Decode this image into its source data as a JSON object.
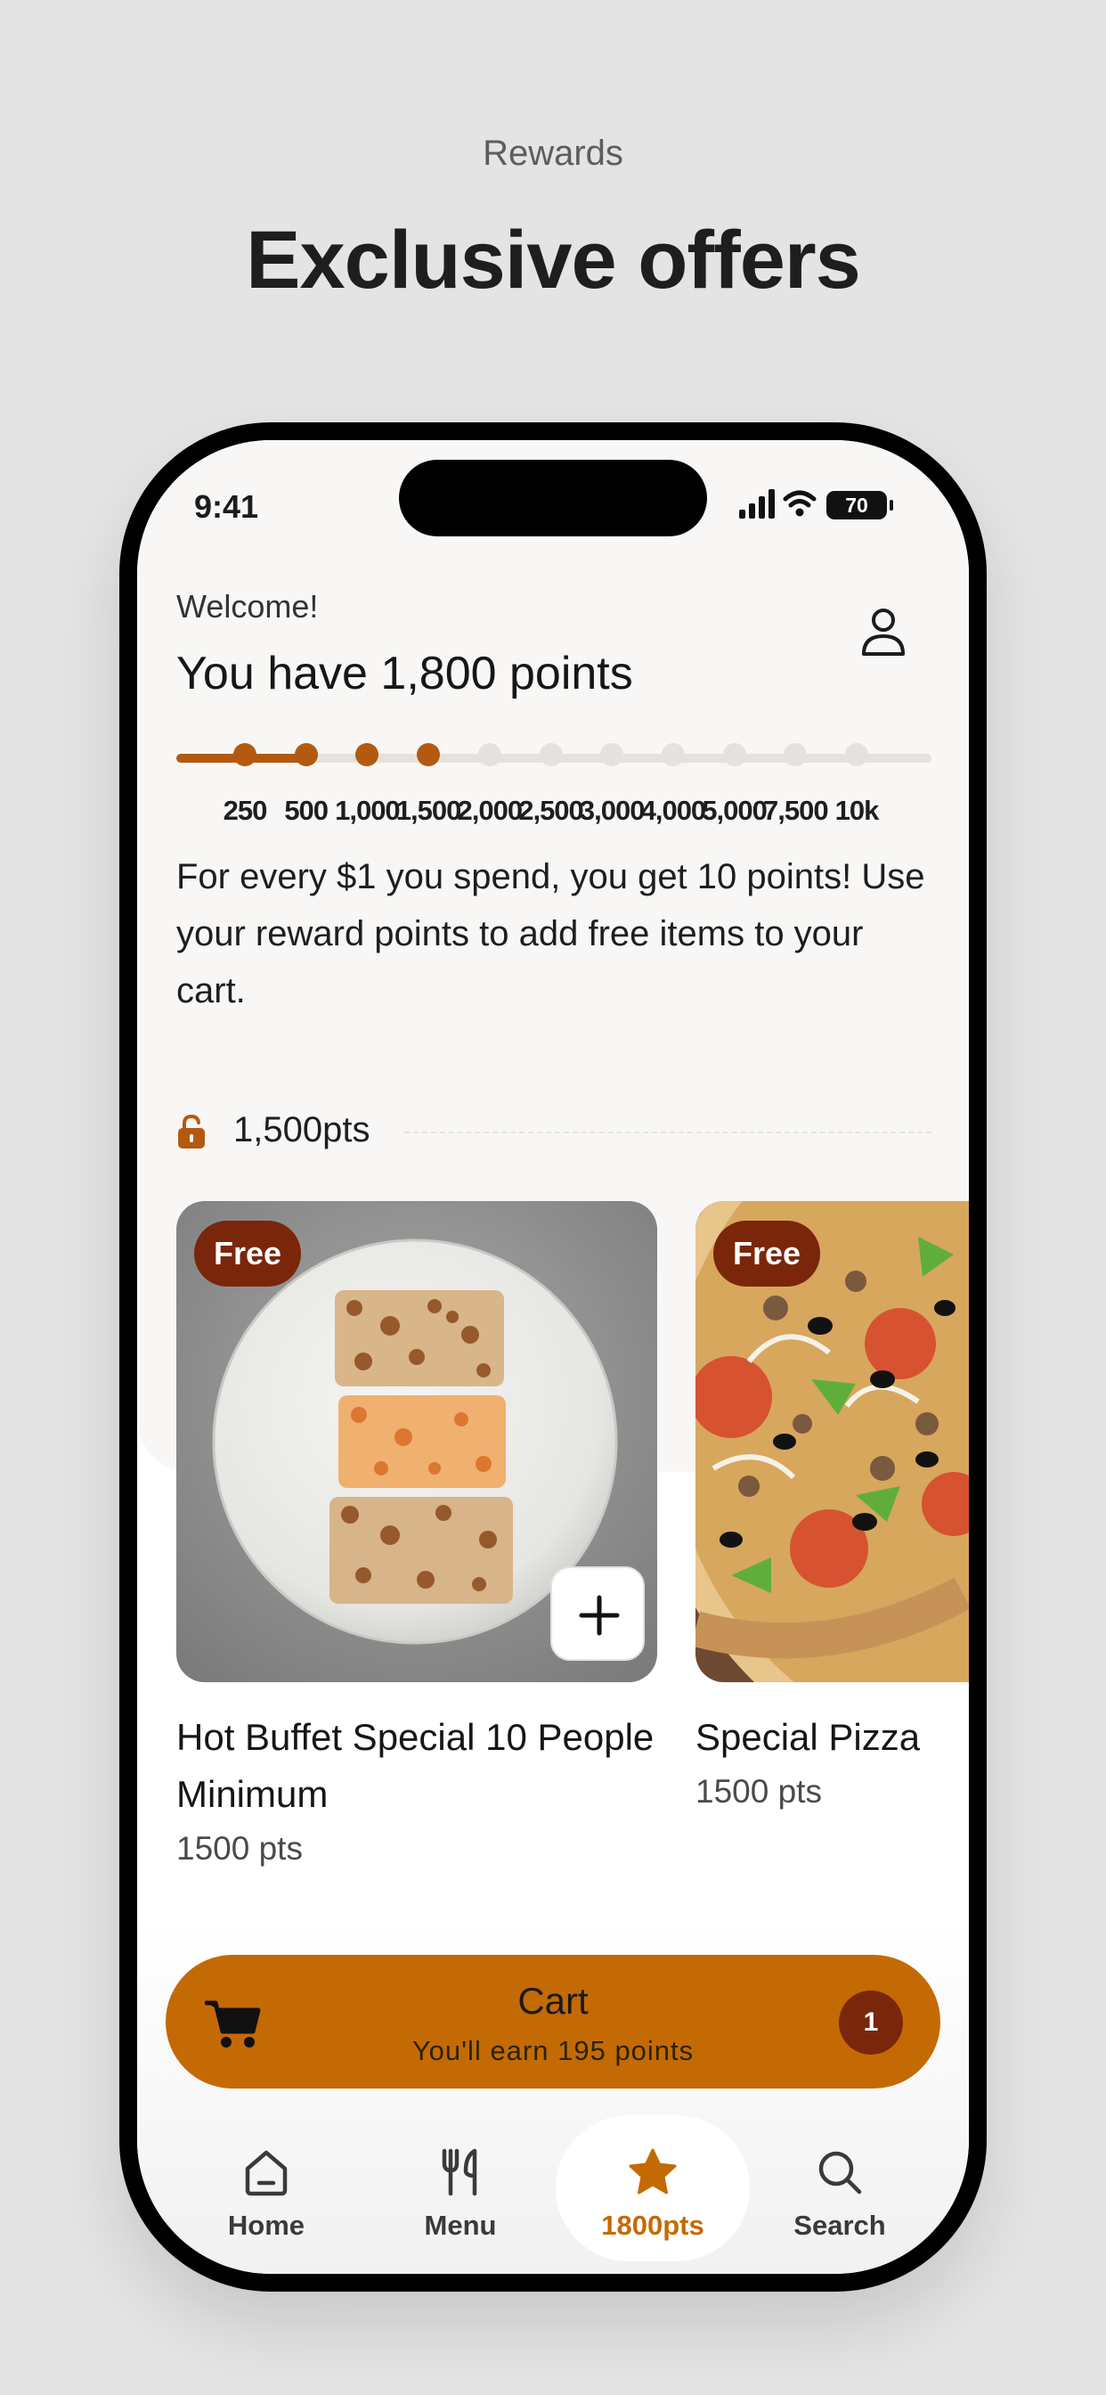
{
  "promo": {
    "eyebrow": "Rewards",
    "title": "Exclusive offers"
  },
  "status_bar": {
    "time": "9:41",
    "battery": "70"
  },
  "header": {
    "welcome": "Welcome!",
    "points_title": "You have 1,800 points",
    "profile_icon": "person-icon"
  },
  "progress": {
    "current_points": 1800,
    "tiers": [
      {
        "label": "250",
        "reached": true
      },
      {
        "label": "500",
        "reached": true
      },
      {
        "label": "1,000",
        "reached": true
      },
      {
        "label": "1,500",
        "reached": true
      },
      {
        "label": "2,000",
        "reached": false
      },
      {
        "label": "2,500",
        "reached": false
      },
      {
        "label": "3,000",
        "reached": false
      },
      {
        "label": "4,000",
        "reached": false
      },
      {
        "label": "5,000",
        "reached": false
      },
      {
        "label": "7,500",
        "reached": false
      },
      {
        "label": "10k",
        "reached": false
      }
    ]
  },
  "info_text": "For every $1 you spend, you get 10 points! Use your reward points to add free items to your cart.",
  "tier_section": {
    "label": "1,500pts",
    "icon": "unlocked-lock-icon"
  },
  "items": [
    {
      "badge": "Free",
      "name": "Hot Buffet Special 10 People Minimum",
      "pts": "1500 pts",
      "add_icon": "plus-icon"
    },
    {
      "badge": "Free",
      "name": "Special Pizza",
      "pts": "1500 pts"
    }
  ],
  "cart": {
    "title": "Cart",
    "subtitle": "You'll earn 195 points",
    "count": "1",
    "icon": "cart-icon"
  },
  "nav": {
    "items": [
      {
        "label": "Home",
        "icon": "home-icon"
      },
      {
        "label": "Menu",
        "icon": "utensils-icon"
      },
      {
        "label": "1800pts",
        "icon": "star-icon",
        "active": true
      },
      {
        "label": "Search",
        "icon": "search-icon"
      }
    ]
  },
  "colors": {
    "accent": "#c46a04",
    "progress": "#b45a10",
    "badge": "#7a260b",
    "panel": "#f8f7f5"
  }
}
